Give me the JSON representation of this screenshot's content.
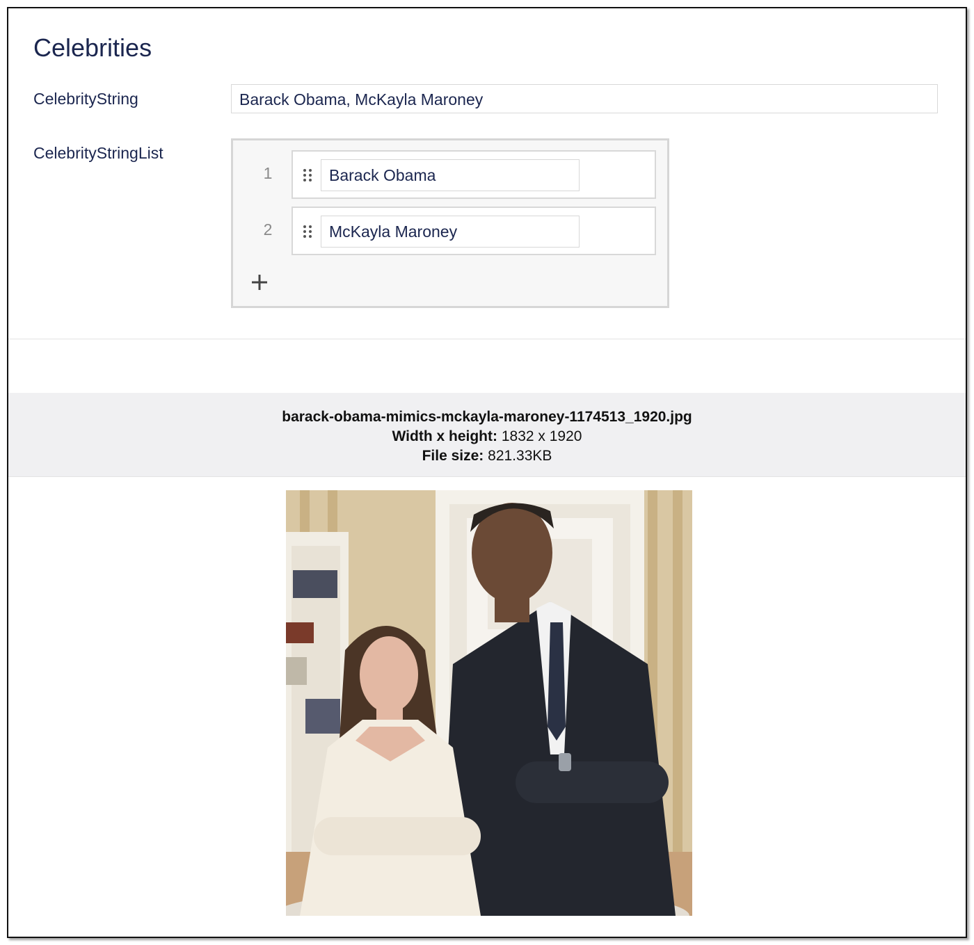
{
  "section": {
    "title": "Celebrities"
  },
  "fields": {
    "celebrity_string": {
      "label": "CelebrityString",
      "value": "Barack Obama, McKayla Maroney"
    },
    "celebrity_string_list": {
      "label": "CelebrityStringList",
      "items": [
        {
          "index": "1",
          "value": "Barack Obama"
        },
        {
          "index": "2",
          "value": "McKayla Maroney"
        }
      ]
    }
  },
  "image_info": {
    "filename": "barack-obama-mimics-mckayla-maroney-1174513_1920.jpg",
    "dimensions_label": "Width x height:",
    "dimensions_value": "1832 x 1920",
    "filesize_label": "File size:",
    "filesize_value": "821.33KB"
  },
  "icons": {
    "drag": "drag-handle-icon",
    "add": "plus-icon"
  }
}
